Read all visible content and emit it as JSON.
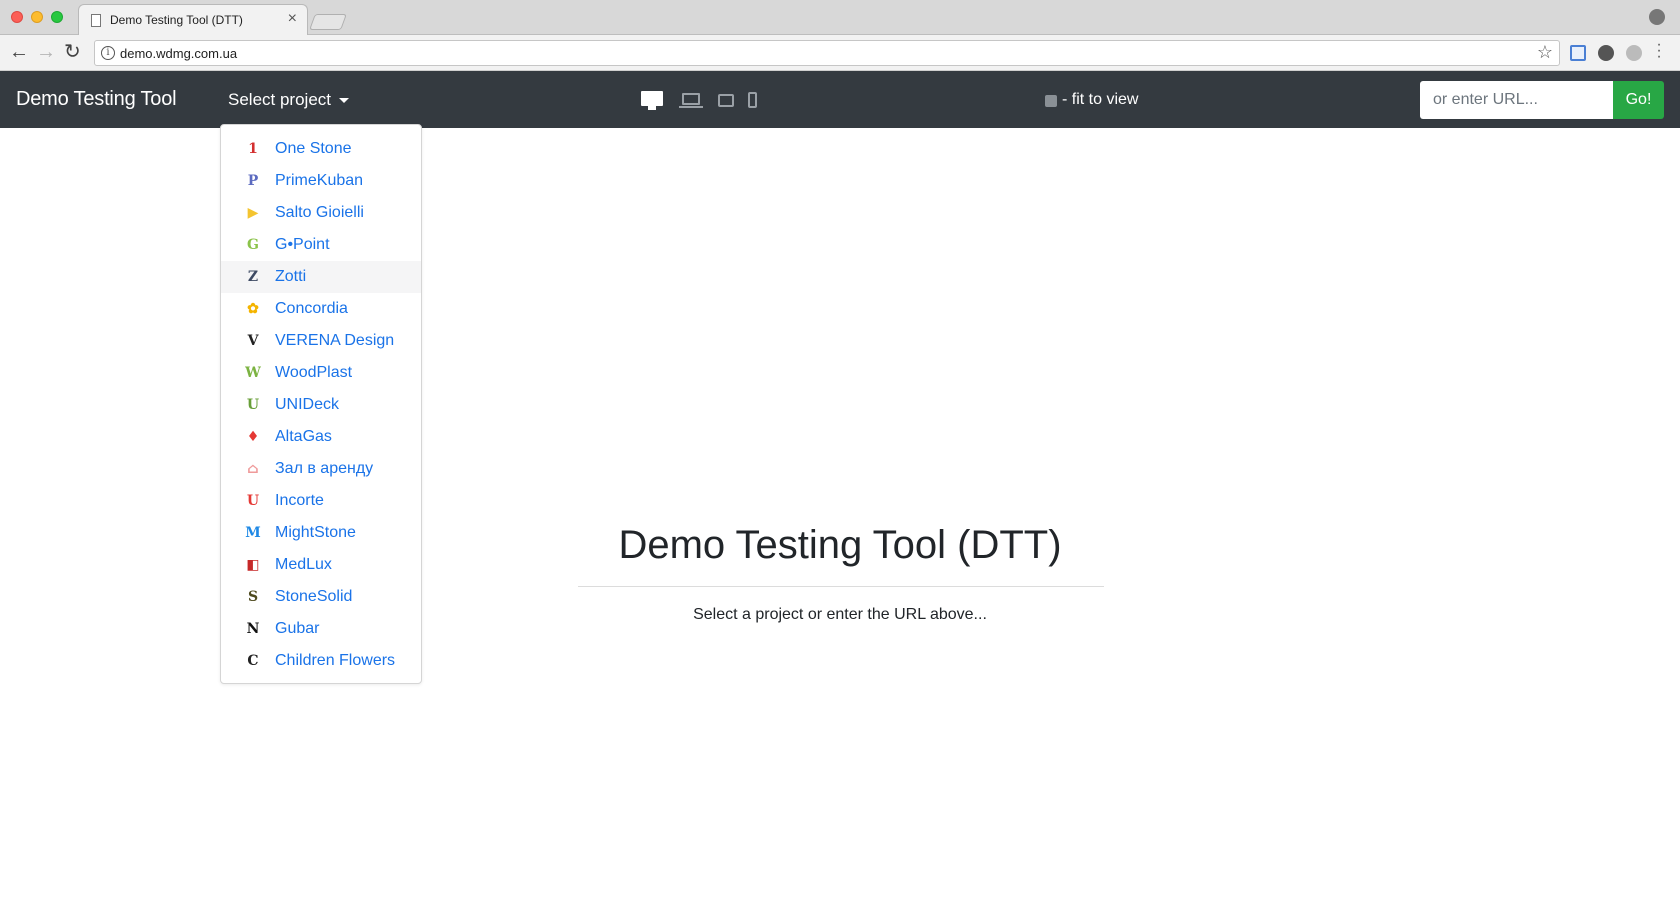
{
  "browser": {
    "tab_title": "Demo Testing Tool (DTT)",
    "close_glyph": "×",
    "url": "demo.wdmg.com.ua"
  },
  "navbar": {
    "brand": "Demo Testing Tool",
    "select_project": "Select project",
    "fit_label": "- fit to view",
    "url_placeholder": "or enter URL...",
    "go_label": "Go!"
  },
  "dropdown": {
    "items": [
      {
        "label": "One Stone",
        "icon": "one-stone-logo",
        "glyph": "1",
        "color": "#d32f2f"
      },
      {
        "label": "PrimeKuban",
        "icon": "primekuban-logo",
        "glyph": "P",
        "color": "#5c6bc0"
      },
      {
        "label": "Salto Gioielli",
        "icon": "salto-gioielli-logo",
        "glyph": "▶",
        "color": "#f4c430"
      },
      {
        "label": "G•Point",
        "icon": "g-point-logo",
        "glyph": "G",
        "color": "#8bc34a"
      },
      {
        "label": "Zotti",
        "icon": "zotti-logo",
        "glyph": "Z",
        "color": "#3d4a63"
      },
      {
        "label": "Concordia",
        "icon": "concordia-logo",
        "glyph": "✿",
        "color": "#f4b400"
      },
      {
        "label": "VERENA Design",
        "icon": "verena-design-logo",
        "glyph": "V",
        "color": "#222222"
      },
      {
        "label": "WoodPlast",
        "icon": "woodplast-logo",
        "glyph": "W",
        "color": "#7cb342"
      },
      {
        "label": "UNIDeck",
        "icon": "unideck-logo",
        "glyph": "U",
        "color": "#689f38"
      },
      {
        "label": "AltaGas",
        "icon": "altagas-logo",
        "glyph": "♦",
        "color": "#e53935"
      },
      {
        "label": "Зал в аренду",
        "icon": "zal-v-arendu-logo",
        "glyph": "⌂",
        "color": "#ef9a9a"
      },
      {
        "label": "Incorte",
        "icon": "incorte-logo",
        "glyph": "U",
        "color": "#e53935"
      },
      {
        "label": "MightStone",
        "icon": "mightstone-logo",
        "glyph": "M",
        "color": "#1e88e5"
      },
      {
        "label": "MedLux",
        "icon": "medlux-logo",
        "glyph": "◧",
        "color": "#c62828"
      },
      {
        "label": "StoneSolid",
        "icon": "stonesolid-logo",
        "glyph": "S",
        "color": "#4e4a1e"
      },
      {
        "label": "Gubar",
        "icon": "gubar-logo",
        "glyph": "N",
        "color": "#111111"
      },
      {
        "label": "Children Flowers",
        "icon": "children-flowers-logo",
        "glyph": "C",
        "color": "#222222"
      }
    ],
    "hovered_index": 4
  },
  "main": {
    "title": "Demo Testing Tool (DTT)",
    "subtitle": "Select a project or enter the URL above..."
  },
  "colors": {
    "navbar_bg": "#343a40",
    "go_button": "#28a745",
    "link": "#1a73e8"
  }
}
